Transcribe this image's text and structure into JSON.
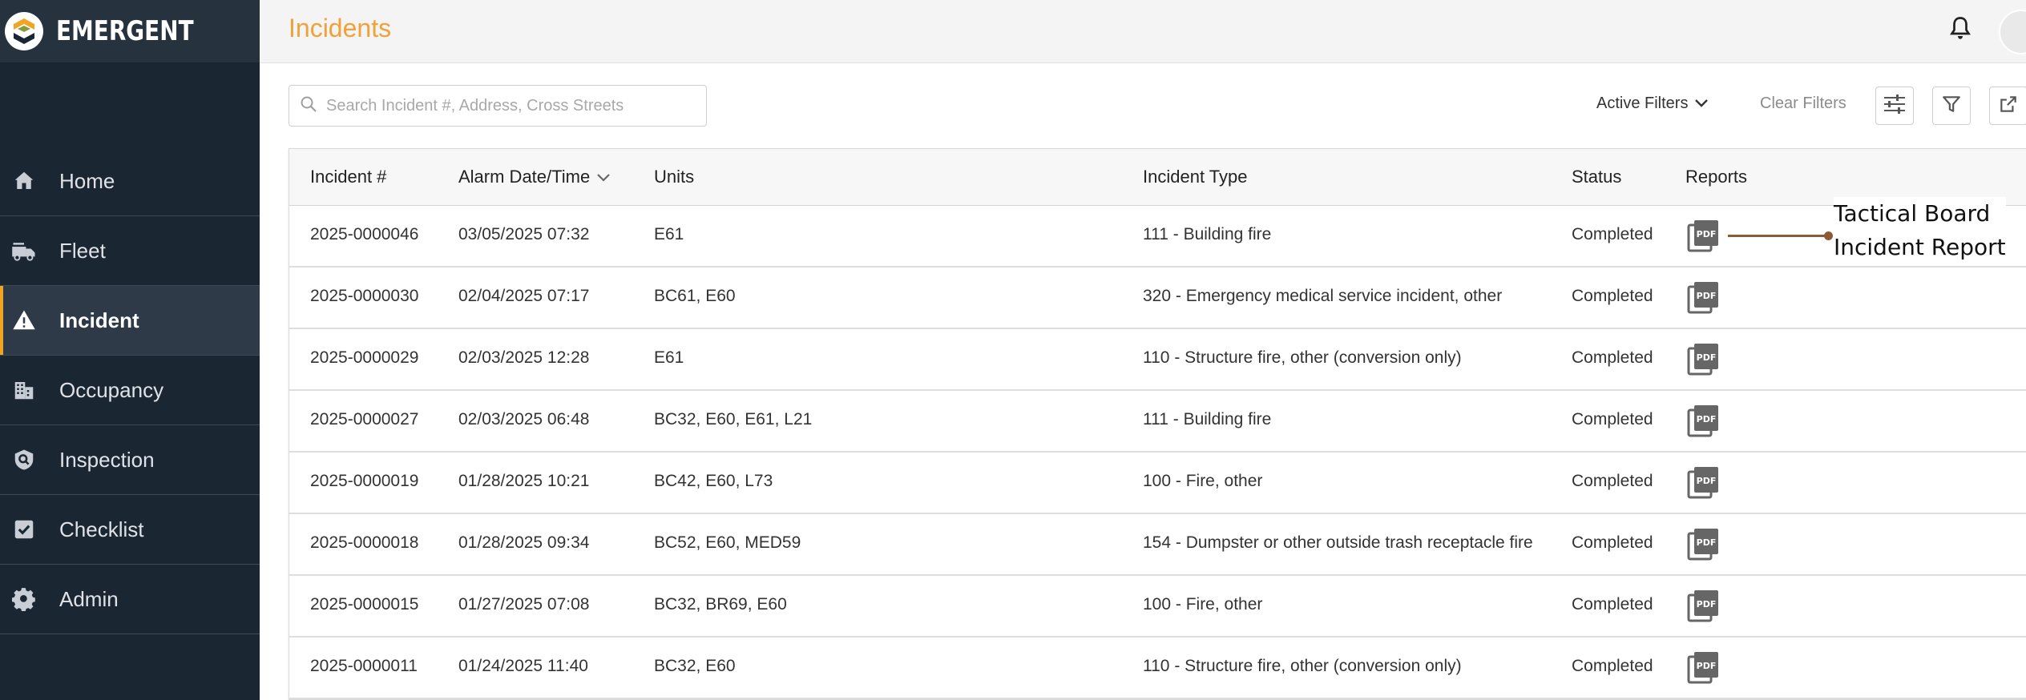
{
  "app": {
    "brand": "EMERGENT"
  },
  "header": {
    "title": "Incidents"
  },
  "sidebar": {
    "items": [
      {
        "label": "Home",
        "icon": "home-icon",
        "active": false
      },
      {
        "label": "Fleet",
        "icon": "fire-truck-icon",
        "active": false
      },
      {
        "label": "Incident",
        "icon": "warning-icon",
        "active": true
      },
      {
        "label": "Occupancy",
        "icon": "building-icon",
        "active": false
      },
      {
        "label": "Inspection",
        "icon": "shield-icon",
        "active": false
      },
      {
        "label": "Checklist",
        "icon": "checkbox-icon",
        "active": false
      },
      {
        "label": "Admin",
        "icon": "gear-icon",
        "active": false
      }
    ]
  },
  "toolbar": {
    "search_placeholder": "Search Incident #, Address, Cross Streets",
    "active_filters_label": "Active Filters",
    "clear_filters_label": "Clear Filters"
  },
  "table": {
    "columns": [
      "Incident #",
      "Alarm Date/Time",
      "Units",
      "Incident Type",
      "Status",
      "Reports"
    ],
    "rows": [
      {
        "incident": "2025-0000046",
        "alarm": "03/05/2025 07:32",
        "units": "E61",
        "type": "111 - Building fire",
        "status": "Completed"
      },
      {
        "incident": "2025-0000030",
        "alarm": "02/04/2025 07:17",
        "units": "BC61, E60",
        "type": "320 - Emergency medical service incident, other",
        "status": "Completed"
      },
      {
        "incident": "2025-0000029",
        "alarm": "02/03/2025 12:28",
        "units": "E61",
        "type": "110 - Structure fire, other (conversion only)",
        "status": "Completed"
      },
      {
        "incident": "2025-0000027",
        "alarm": "02/03/2025 06:48",
        "units": "BC32, E60, E61, L21",
        "type": "111 - Building fire",
        "status": "Completed"
      },
      {
        "incident": "2025-0000019",
        "alarm": "01/28/2025 10:21",
        "units": "BC42, E60, L73",
        "type": "100 - Fire, other",
        "status": "Completed"
      },
      {
        "incident": "2025-0000018",
        "alarm": "01/28/2025 09:34",
        "units": "BC52, E60, MED59",
        "type": "154 - Dumpster or other outside trash receptacle fire",
        "status": "Completed"
      },
      {
        "incident": "2025-0000015",
        "alarm": "01/27/2025 07:08",
        "units": "BC32, BR69, E60",
        "type": "100 - Fire, other",
        "status": "Completed"
      },
      {
        "incident": "2025-0000011",
        "alarm": "01/24/2025 11:40",
        "units": "BC32, E60",
        "type": "110 - Structure fire, other (conversion only)",
        "status": "Completed"
      }
    ]
  },
  "callout": {
    "line1": "Tactical Board",
    "line2": "Incident Report"
  },
  "colors": {
    "accent": "#f0a13a",
    "sidebar_bg": "#1b2633",
    "callout": "#8c5a35"
  }
}
